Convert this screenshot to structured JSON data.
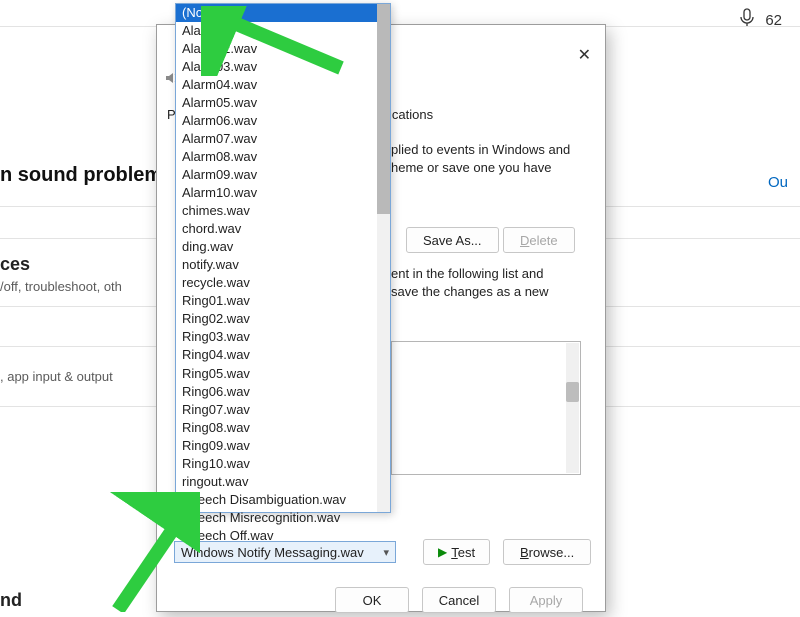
{
  "topbar": {
    "mic_icon": "mic-icon",
    "number": "62"
  },
  "background": {
    "heading1": "n sound problems",
    "link_label": "Ou",
    "heading2": "ces",
    "sub": "/off, troubleshoot, oth",
    "row3": ", app input & output",
    "bottom_cut": "nd"
  },
  "dialog": {
    "close_icon": "close-icon",
    "header_icon": "speaker-icon",
    "tab_left": "Pla",
    "tab_right": "ications",
    "desc_line1": "plied to events in Windows and",
    "desc_line2": "heme or save one you have",
    "save_as_label": "Save As...",
    "delete_label": "Delete",
    "desc2_line1": "ent in the following list and",
    "desc2_line2": "save the changes as a new",
    "selected_sound": "Windows Notify Messaging.wav",
    "test_label": "Test",
    "browse_label": "Browse...",
    "ok_label": "OK",
    "cancel_label": "Cancel",
    "apply_label": "Apply"
  },
  "dropdown": {
    "items": [
      "(None)",
      "Alarm01.",
      "Alarm02.wav",
      "Alarm03.wav",
      "Alarm04.wav",
      "Alarm05.wav",
      "Alarm06.wav",
      "Alarm07.wav",
      "Alarm08.wav",
      "Alarm09.wav",
      "Alarm10.wav",
      "chimes.wav",
      "chord.wav",
      "ding.wav",
      "notify.wav",
      "recycle.wav",
      "Ring01.wav",
      "Ring02.wav",
      "Ring03.wav",
      "Ring04.wav",
      "Ring05.wav",
      "Ring06.wav",
      "Ring07.wav",
      "Ring08.wav",
      "Ring09.wav",
      "Ring10.wav",
      "ringout.wav",
      "Speech Disambiguation.wav",
      "Speech Misrecognition.wav",
      "Speech Off.wav"
    ],
    "selected_index": 0
  }
}
